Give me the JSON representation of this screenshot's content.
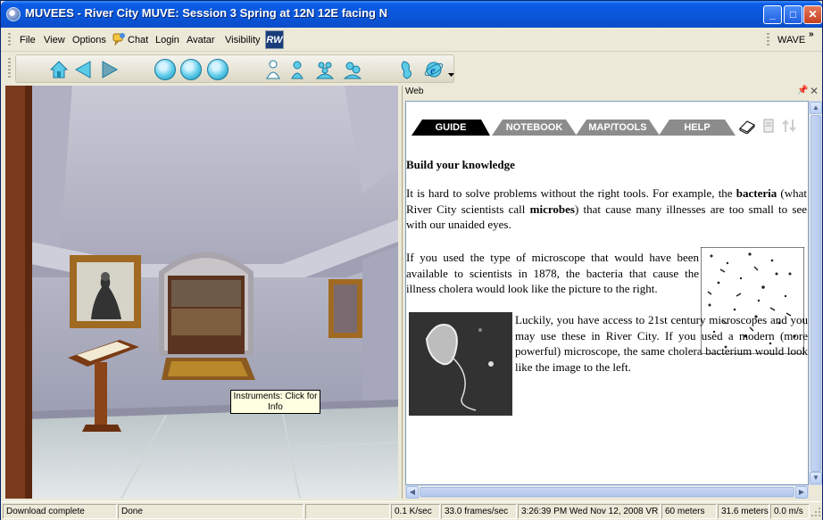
{
  "window": {
    "title": "MUVEES - River City MUVE: Session 3 Spring at 12N 12E facing N",
    "min_label": "_",
    "max_label": "□",
    "close_label": "✕"
  },
  "menu": {
    "items": [
      "File",
      "View",
      "Options",
      "Chat",
      "Login",
      "Avatar",
      "Visibility"
    ],
    "logo_text": "RW",
    "wave_label": "WAVE",
    "overflow_label": "»"
  },
  "scene": {
    "tooltip": "Instruments: Click for Info"
  },
  "web": {
    "panel_label": "Web",
    "tabs": [
      {
        "label": "GUIDE",
        "active": true
      },
      {
        "label": "NOTEBOOK",
        "active": false
      },
      {
        "label": "MAP/TOOLS",
        "active": false
      },
      {
        "label": "HELP",
        "active": false
      }
    ],
    "heading": "Build your knowledge",
    "para1_a": "It is hard to solve problems without the right tools. For example, the ",
    "para1_b": "bacteria",
    "para1_c": " (what River City scientists call ",
    "para1_d": "microbes",
    "para1_e": ") that cause many illnesses are too small to see with our unaided eyes.",
    "para2": "If you used the type of microscope that would have been available to scientists in 1878, the bacteria that cause the illness cholera would look like the picture to the right.",
    "para3": "Luckily, you have access to 21st century microscopes and you may use these in River City. If you used a modern (more powerful) microscope, the same cholera bacterium would look like the image to the left."
  },
  "status": {
    "left": "Download complete",
    "done": "Done",
    "rate": "0.1 K/sec",
    "fps": "33.0 frames/sec",
    "datetime": "3:26:39 PM Wed Nov 12, 2008 VR",
    "distance1": "60 meters",
    "distance2": "31.6 meters",
    "speed": "0.0 m/s"
  },
  "colors": {
    "title_blue": "#0a55d8",
    "tab_active": "#000000",
    "tab_inactive": "#8c8c8c",
    "tooltip_bg": "#ffffe1"
  }
}
